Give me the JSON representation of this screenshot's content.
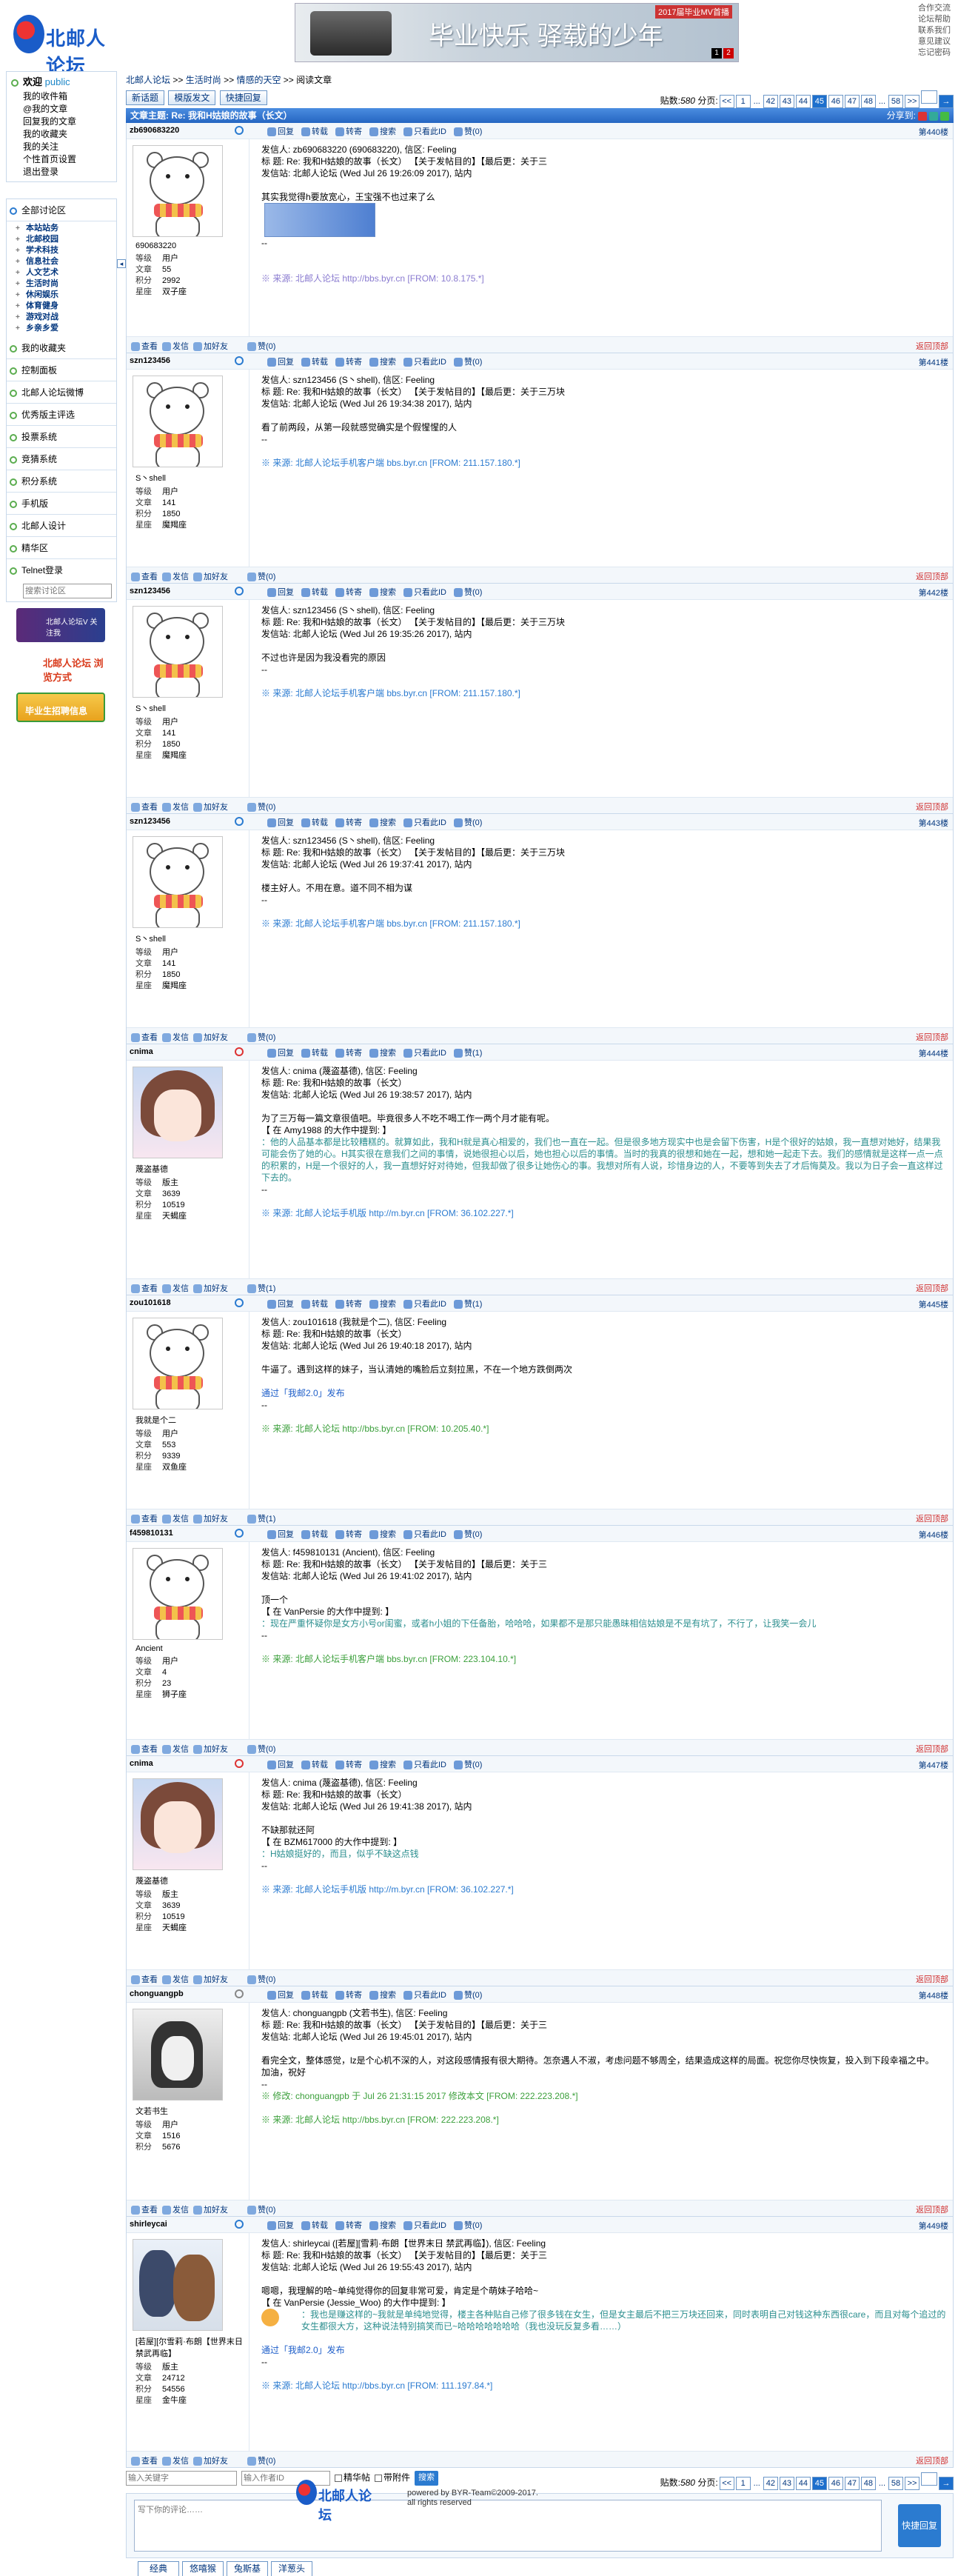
{
  "header": {
    "logo_text": "北邮人论坛",
    "banner_tag": "2017届毕业MV首播",
    "banner_text": "毕业快乐 驿载的少年",
    "banner_pages": [
      "1",
      "2"
    ],
    "toplinks": [
      "合作交流",
      "论坛帮助",
      "联系我们",
      "意见建议",
      "忘记密码"
    ]
  },
  "sidebar": {
    "welcome": "欢迎",
    "username": "public",
    "user_links": [
      "我的收件箱",
      "@我的文章",
      "回复我的文章",
      "我的收藏夹",
      "我的关注",
      "个性首页设置",
      "退出登录"
    ],
    "all_boards": "全部讨论区",
    "boards": [
      "本站站务",
      "北邮校园",
      "学术科技",
      "信息社会",
      "人文艺术",
      "生活时尚",
      "休闲娱乐",
      "体育健身",
      "游戏对战",
      "乡亲乡爱"
    ],
    "sections": [
      "我的收藏夹",
      "控制面板",
      "北邮人论坛微博",
      "优秀版主评选",
      "投票系统",
      "竞猜系统",
      "积分系统",
      "手机版",
      "北邮人设计",
      "精华区",
      "Telnet登录"
    ],
    "search_placeholder": "搜索讨论区",
    "ad1": "北邮人论坛V 关注我",
    "ad2": "北邮人论坛 浏览方式",
    "ad3": "毕业生招聘信息"
  },
  "main": {
    "breadcrumb": [
      "北邮人论坛",
      ">>",
      "生活时尚",
      ">>",
      "情感的天空",
      ">>",
      "阅读文章"
    ],
    "toolbar": {
      "new": "新话题",
      "post": "模版发文",
      "quick": "快捷回复"
    },
    "pager": {
      "total_label": "贴数:",
      "total": "580",
      "pages_label": "分页:",
      "pages": [
        "<<",
        "1",
        "...",
        "42",
        "43",
        "44",
        "45",
        "46",
        "47",
        "48",
        "...",
        "58",
        ">>"
      ],
      "current": "45"
    },
    "subject": "文章主题: Re: 我和H姑娘的故事（长文）",
    "share": "分享到:",
    "actions": [
      "回复",
      "转载",
      "转寄",
      "搜索",
      "只看此ID",
      "赞(0)"
    ],
    "foot_actions": [
      "查看",
      "发信",
      "加好友"
    ],
    "foot_like": "赞(0)",
    "back_top": "返回顶部",
    "stat_labels": [
      "等级",
      "文章",
      "积分",
      "星座"
    ]
  },
  "posts": [
    {
      "uid": "zb690683220",
      "floor": "第440楼",
      "nick": "690683220",
      "stats": [
        "用户",
        "55",
        "2992",
        "双子座"
      ],
      "like": "赞(0)",
      "foot_like": "赞(0)",
      "lines": [
        "发信人: zb690683220 (690683220), 信区: Feeling",
        "标  题: Re: 我和H姑娘的故事（长文） 【关于发帖目的】【最后更：关于三",
        "发信站: 北邮人论坛 (Wed Jul 26 19:26:09 2017), 站内",
        "",
        "其实我觉得h要放宽心，王宝强不也过来了么",
        "--",
        ""
      ],
      "src": "※ 来源: 北邮人论坛 http://bbs.byr.cn [FROM: 10.8.175.*]"
    },
    {
      "uid": "szn123456",
      "floor": "第441楼",
      "nick": "S丶shell",
      "stats": [
        "用户",
        "141",
        "1850",
        "魔羯座"
      ],
      "like": "赞(0)",
      "foot_like": "赞(0)",
      "lines": [
        "发信人: szn123456 (S丶shell), 信区: Feeling",
        "标  题: Re: 我和H姑娘的故事（长文） 【关于发帖目的】【最后更：关于三万块",
        "发信站: 北邮人论坛 (Wed Jul 26 19:34:38 2017), 站内",
        "",
        "看了前两段，从第一段就感觉确实是个假惺惺的人",
        "--"
      ],
      "src": "※ 来源: 北邮人论坛手机客户端 bbs.byr.cn [FROM: 211.157.180.*]"
    },
    {
      "uid": "szn123456",
      "floor": "第442楼",
      "nick": "S丶shell",
      "stats": [
        "用户",
        "141",
        "1850",
        "魔羯座"
      ],
      "like": "赞(0)",
      "foot_like": "赞(0)",
      "lines": [
        "发信人: szn123456 (S丶shell), 信区: Feeling",
        "标  题: Re: 我和H姑娘的故事（长文） 【关于发帖目的】【最后更：关于三万块",
        "发信站: 北邮人论坛 (Wed Jul 26 19:35:26 2017), 站内",
        "",
        "不过也许是因为我没看完的原因",
        "--"
      ],
      "src": "※ 来源: 北邮人论坛手机客户端 bbs.byr.cn [FROM: 211.157.180.*]"
    },
    {
      "uid": "szn123456",
      "floor": "第443楼",
      "nick": "S丶shell",
      "stats": [
        "用户",
        "141",
        "1850",
        "魔羯座"
      ],
      "like": "赞(0)",
      "foot_like": "赞(0)",
      "lines": [
        "发信人: szn123456 (S丶shell), 信区: Feeling",
        "标  题: Re: 我和H姑娘的故事（长文） 【关于发帖目的】【最后更：关于三万块",
        "发信站: 北邮人论坛 (Wed Jul 26 19:37:41 2017), 站内",
        "",
        "楼主好人。不用在意。道不同不相为谋",
        "--"
      ],
      "src": "※ 来源: 北邮人论坛手机客户端 bbs.byr.cn [FROM: 211.157.180.*]"
    },
    {
      "uid": "cnima",
      "floor": "第444楼",
      "nick": "蔑盗基德",
      "stats": [
        "版主",
        "3639",
        "10519",
        "天蝎座"
      ],
      "like": "赞(1)",
      "foot_like": "赞(1)",
      "lines": [
        "发信人: cnima (蔑盗基德), 信区: Feeling",
        "标  题: Re: 我和H姑娘的故事（长文）",
        "发信站: 北邮人论坛 (Wed Jul 26 19:38:57 2017), 站内",
        "",
        "为了三万每一篇文章很值吧。毕竟很多人不吃不喝工作一两个月才能有呢。",
        "【 在 Amy1988 的大作中提到: 】"
      ],
      "quote": "：他的人品基本都是比较糟糕的。就算如此，我和H就是真心相爱的，我们也一直在一起。但是很多地方现实中也是会留下伤害，H是个很好的姑娘，我一直想对她好，结果我可能会伤了她的心。H其实很在意我们之间的事情，说她很担心以后，她也担心以后的事情。当时的我真的很想和她在一起，想和她一起走下去。我们的感情就是这样一点一点的积累的，H是一个很好的人，我一直想好好对待她，但我却做了很多让她伤心的事。我想对所有人说，珍惜身边的人，不要等到失去了才后悔莫及。我以为日子会一直这样过下去的。",
      "src": "※ 来源: 北邮人论坛手机版 http://m.byr.cn [FROM: 36.102.227.*]"
    },
    {
      "uid": "zou101618",
      "floor": "第445楼",
      "nick": "我就是个二",
      "stats": [
        "用户",
        "553",
        "9339",
        "双鱼座"
      ],
      "like": "赞(1)",
      "foot_like": "赞(1)",
      "lines": [
        "发信人: zou101618 (我就是个二), 信区: Feeling",
        "标  题: Re: 我和H姑娘的故事（长文）",
        "发信站: 北邮人论坛 (Wed Jul 26 19:40:18 2017), 站内",
        "",
        "牛逼了。遇到这样的妹子，当认清她的嘴脸后立刻拉黑，不在一个地方跌倒两次",
        "",
        "通过「我邮2.0」发布",
        "--"
      ],
      "src": "※ 来源: 北邮人论坛 http://bbs.byr.cn [FROM: 10.205.40.*]"
    },
    {
      "uid": "f459810131",
      "floor": "第446楼",
      "nick": "Ancient",
      "stats": [
        "用户",
        "4",
        "23",
        "狮子座"
      ],
      "like": "赞(0)",
      "foot_like": "赞(0)",
      "lines": [
        "发信人: f459810131 (Ancient), 信区: Feeling",
        "标  题: Re: 我和H姑娘的故事（长文） 【关于发帖目的】【最后更：关于三",
        "发信站: 北邮人论坛 (Wed Jul 26 19:41:02 2017), 站内",
        "",
        "顶一个",
        "【 在 VanPersie 的大作中提到: 】"
      ],
      "quote": "：现在严重怀疑你是女方小号or闺蜜，或者h小姐的下任备胎，哈哈哈，如果都不是那只能愚昧相信姑娘是不是有坑了，不行了，让我笑一会儿",
      "src": "※ 来源: 北邮人论坛手机客户端 bbs.byr.cn [FROM: 223.104.10.*]"
    },
    {
      "uid": "cnima",
      "floor": "第447楼",
      "nick": "蔑盗基德",
      "stats": [
        "版主",
        "3639",
        "10519",
        "天蝎座"
      ],
      "like": "赞(0)",
      "foot_like": "赞(0)",
      "lines": [
        "发信人: cnima (蔑盗基德), 信区: Feeling",
        "标  题: Re: 我和H姑娘的故事（长文）",
        "发信站: 北邮人论坛 (Wed Jul 26 19:41:38 2017), 站内",
        "",
        "不缺那就还阿",
        "【 在 BZM617000 的大作中提到: 】"
      ],
      "quote": "：H姑娘挺好的，而且，似乎不缺这点钱",
      "src": "※ 来源: 北邮人论坛手机版 http://m.byr.cn [FROM: 36.102.227.*]"
    },
    {
      "uid": "chonguangpb",
      "floor": "第448楼",
      "nick": "文若书生",
      "stats": [
        "用户",
        "1516",
        "5676",
        ""
      ],
      "like": "赞(0)",
      "foot_like": "赞(0)",
      "lines": [
        "发信人: chonguangpb (文若书生), 信区: Feeling",
        "标  题: Re: 我和H姑娘的故事（长文） 【关于发帖目的】【最后更：关于三",
        "发信站: 北邮人论坛 (Wed Jul 26 19:45:01 2017), 站内",
        "",
        "看完全文，整体感觉，lz是个心机不深的人，对这段感情报有很大期待。怎奈遇人不淑，考虑问题不够周全，结果造成这样的局面。祝您你尽快恢复，投入到下段幸福之中。",
        "加油，祝好",
        "--"
      ],
      "extra": "※ 修改: chonguangpb 于 Jul 26 21:31:15 2017 修改本文 [FROM: 222.223.208.*]",
      "src": "※ 来源: 北邮人论坛 http://bbs.byr.cn [FROM: 222.223.208.*]"
    },
    {
      "uid": "shirleycai",
      "floor": "第449楼",
      "nick": "[若屋][尔雪莉·布朗【世界末日 禁武再临】",
      "stats": [
        "版主",
        "24712",
        "54556",
        "金牛座"
      ],
      "like": "赞(0)",
      "foot_like": "赞(0)",
      "lines": [
        "发信人: shirleycai ([若屋][雪莉·布朗【世界末日 禁武再临】), 信区: Feeling",
        "标  题: Re: 我和H姑娘的故事（长文） 【关于发帖目的】【最后更：关于三",
        "发信站: 北邮人论坛 (Wed Jul 26 19:55:43 2017), 站内",
        "",
        "嗯嗯，我理解的哈~单纯觉得你的回复非常可爱，肯定是个萌妹子哈哈~",
        "【 在 VanPersie (Jessie_Woo) 的大作中提到: 】"
      ],
      "quote": "：我也是赚这样的~我就是单纯地觉得，楼主各种贴自己修了很多钱在女生，但是女主最后不把三万块还回来，同时表明自己对钱这种东西很care，而且对每个追过的女生都很大方，这种说法特别搞笑而已~哈哈哈哈哈哈哈（我也没玩反复多看……）",
      "tail": [
        "",
        "通过「我邮2.0」发布",
        "--"
      ],
      "src": "※ 来源: 北邮人论坛 http://bbs.byr.cn [FROM: 111.197.84.*]"
    }
  ],
  "bottom": {
    "search_placeholder": "输入关键字",
    "id_placeholder": "输入作者ID",
    "chk1": "精华帖",
    "chk2": "带附件",
    "search_btn": "搜索",
    "reply_placeholder": "写下你的评论……",
    "quick_reply": "快捷回复",
    "emo_tabs": [
      "经典",
      "悠嘻猴",
      "兔斯基",
      "洋葱头"
    ]
  },
  "footer": {
    "logo_text": "北邮人论坛",
    "line1": "powered by BYR-Team©2009-2017.",
    "line2": "all rights reserved"
  },
  "colors": {
    "accent": "#2566c2",
    "link": "#02367e",
    "quote": "#2c8f8f",
    "source": "#2b7bd0"
  }
}
